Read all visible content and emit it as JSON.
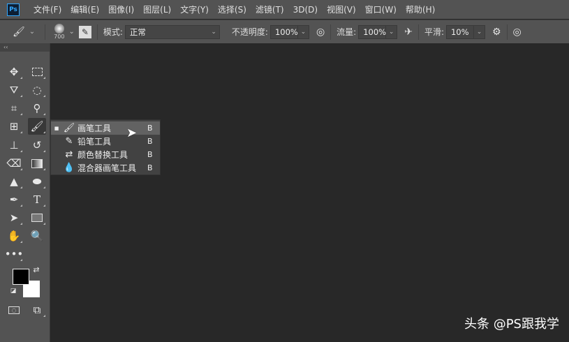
{
  "app": {
    "logo": "Ps"
  },
  "menu": [
    "文件(F)",
    "编辑(E)",
    "图像(I)",
    "图层(L)",
    "文字(Y)",
    "选择(S)",
    "滤镜(T)",
    "3D(D)",
    "视图(V)",
    "窗口(W)",
    "帮助(H)"
  ],
  "options": {
    "brush_size": "700",
    "mode_label": "模式:",
    "mode_value": "正常",
    "opacity_label": "不透明度:",
    "opacity_value": "100%",
    "flow_label": "流量:",
    "flow_value": "100%",
    "smoothing_label": "平滑:",
    "smoothing_value": "10%"
  },
  "toolbar": {
    "collapse": "‹‹"
  },
  "flyout": {
    "items": [
      {
        "label": "画笔工具",
        "key": "B",
        "selected": true
      },
      {
        "label": "铅笔工具",
        "key": "B",
        "selected": false
      },
      {
        "label": "颜色替换工具",
        "key": "B",
        "selected": false
      },
      {
        "label": "混合器画笔工具",
        "key": "B",
        "selected": false
      }
    ]
  },
  "colors": {
    "foreground": "#000000",
    "background": "#ffffff"
  },
  "watermark": "头条 @PS跟我学"
}
